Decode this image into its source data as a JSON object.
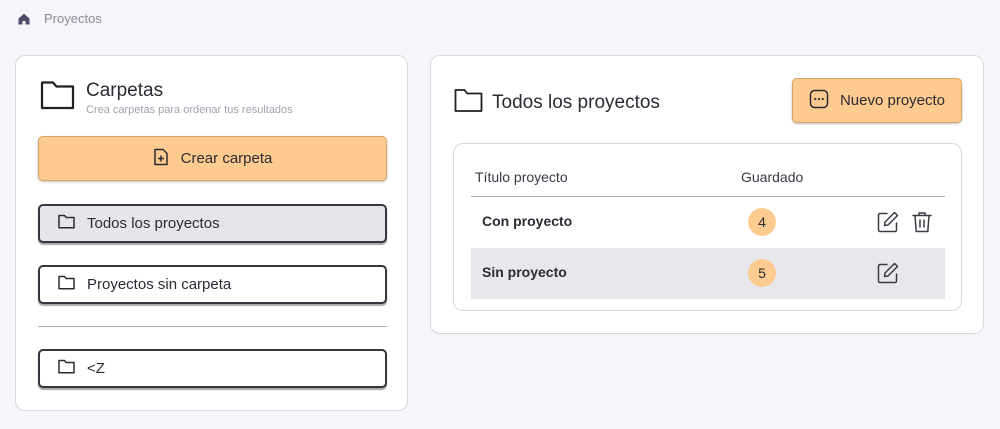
{
  "breadcrumb": {
    "icon": "home-icon",
    "label": "Proyectos"
  },
  "sidebar": {
    "title": "Carpetas",
    "subtitle": "Crea carpetas para ordenar tus resultados",
    "create_button": "Crear carpeta",
    "folders": [
      {
        "label": "Todos los proyectos",
        "active": true
      },
      {
        "label": "Proyectos sin carpeta",
        "active": false
      },
      {
        "label": "<Z",
        "active": false
      }
    ]
  },
  "main": {
    "title": "Todos los proyectos",
    "new_button": "Nuevo proyecto",
    "table": {
      "columns": [
        "Título proyecto",
        "Guardado"
      ],
      "rows": [
        {
          "name": "Con proyecto",
          "saved": "4",
          "actions": [
            "edit-icon",
            "trash-icon"
          ]
        },
        {
          "name": "Sin proyecto",
          "saved": "5",
          "actions": [
            "edit-icon"
          ]
        }
      ]
    }
  },
  "colors": {
    "accent": "#fdca8f",
    "accent_border": "#d5a267",
    "background": "#f6f5fa",
    "active_item": "#e6e5ea",
    "text": "#2b2b33"
  }
}
